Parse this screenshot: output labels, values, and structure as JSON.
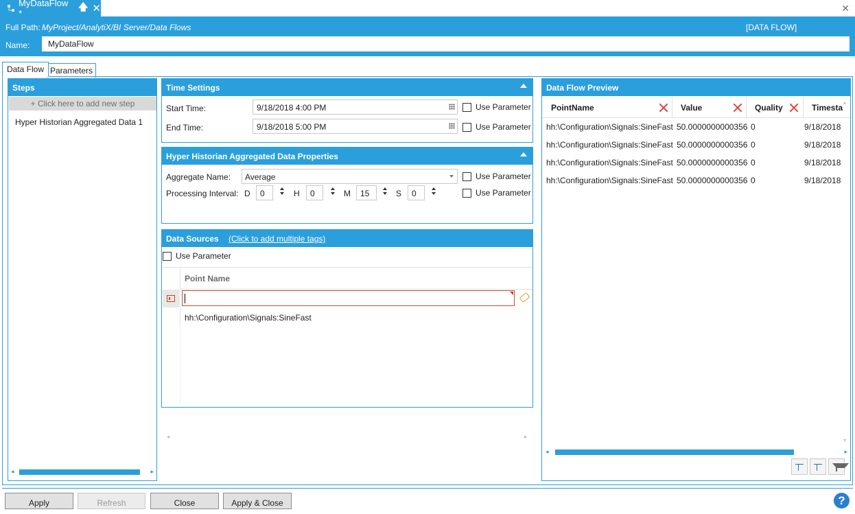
{
  "document_tab": {
    "title": "MyDataFlow *",
    "pin_glyph": "🡅",
    "close_glyph": "✕"
  },
  "window": {
    "close_glyph": "✕"
  },
  "header": {
    "path_label": "Full Path:",
    "path_value": "MyProject/AnalytiX/BI Server/Data Flows",
    "type_label": "[DATA FLOW]",
    "name_label": "Name:",
    "name_value": "MyDataFlow"
  },
  "tabs": [
    {
      "label": "Data Flow",
      "active": true
    },
    {
      "label": "Parameters",
      "active": false
    }
  ],
  "steps": {
    "title": "Steps",
    "add_step": "+  Click here to add new step",
    "items": [
      {
        "label": "Hyper Historian Aggregated Data  1"
      }
    ]
  },
  "time_settings": {
    "title": "Time Settings",
    "start_label": "Start Time:",
    "start_value": "9/18/2018 4:00 PM",
    "end_label": "End Time:",
    "end_value": "9/18/2018 5:00 PM",
    "use_parameter": "Use Parameter"
  },
  "properties": {
    "title": "Hyper Historian Aggregated Data Properties",
    "aggregate_label": "Aggregate Name:",
    "aggregate_value": "Average",
    "interval_label": "Processing Interval:",
    "d_label": "D",
    "d_value": "0",
    "h_label": "H",
    "h_value": "0",
    "m_label": "M",
    "m_value": "15",
    "s_label": "S",
    "s_value": "0",
    "use_parameter": "Use Parameter"
  },
  "data_sources": {
    "title": "Data Sources",
    "add_link": "(Click to add multiple tags)",
    "use_parameter": "Use Parameter",
    "column_header": "Point Name",
    "rows": [
      "hh:\\Configuration\\Signals:SineFast"
    ]
  },
  "preview": {
    "title": "Data Flow Preview",
    "columns": [
      "PointName",
      "Value",
      "Quality",
      "Timesta"
    ],
    "rows": [
      [
        "hh:\\Configuration\\Signals:SineFast",
        "50.0000000000356",
        "0",
        "9/18/2018"
      ],
      [
        "hh:\\Configuration\\Signals:SineFast",
        "50.0000000000356",
        "0",
        "9/18/2018"
      ],
      [
        "hh:\\Configuration\\Signals:SineFast",
        "50.0000000000356",
        "0",
        "9/18/2018"
      ],
      [
        "hh:\\Configuration\\Signals:SineFast",
        "50.0000000000356",
        "0",
        "9/18/2018"
      ]
    ]
  },
  "buttons": {
    "apply": "Apply",
    "refresh": "Refresh",
    "close": "Close",
    "apply_close": "Apply & Close",
    "help": "?"
  },
  "colors": {
    "accent": "#2b9fdb",
    "clear_icon": "#e8413a"
  },
  "icons": [
    "dataflow-icon",
    "pin-icon",
    "close-icon",
    "calendar-icon",
    "chevron-down-icon",
    "clear-filter-icon",
    "tag-icon",
    "help-icon",
    "filter-icon"
  ]
}
